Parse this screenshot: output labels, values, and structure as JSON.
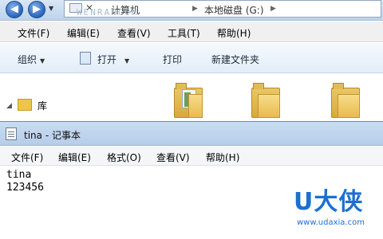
{
  "explorer": {
    "address": {
      "crumb_computer": "计算机",
      "crumb_drive": "本地磁盘 (G:)",
      "watermark": "WENRANCOM"
    },
    "menu": [
      "文件(F)",
      "编辑(E)",
      "查看(V)",
      "工具(T)",
      "帮助(H)"
    ],
    "toolbar": {
      "organize": "组织",
      "open": "打开",
      "print": "打印",
      "new_folder": "新建文件夹"
    },
    "nav": {
      "library": "库"
    }
  },
  "notepad": {
    "title": "tina - 记事本",
    "menu": [
      "文件(F)",
      "编辑(E)",
      "格式(O)",
      "查看(V)",
      "帮助(H)"
    ],
    "content_lines": [
      "tina",
      "123456"
    ]
  },
  "watermark_logo": {
    "main": "U大侠",
    "url": "www.udaxia.com"
  },
  "colors": {
    "accent_blue": "#1c6fd1",
    "folder_yellow": "#e8bb4d",
    "titlebar": "#c9dcf2"
  }
}
